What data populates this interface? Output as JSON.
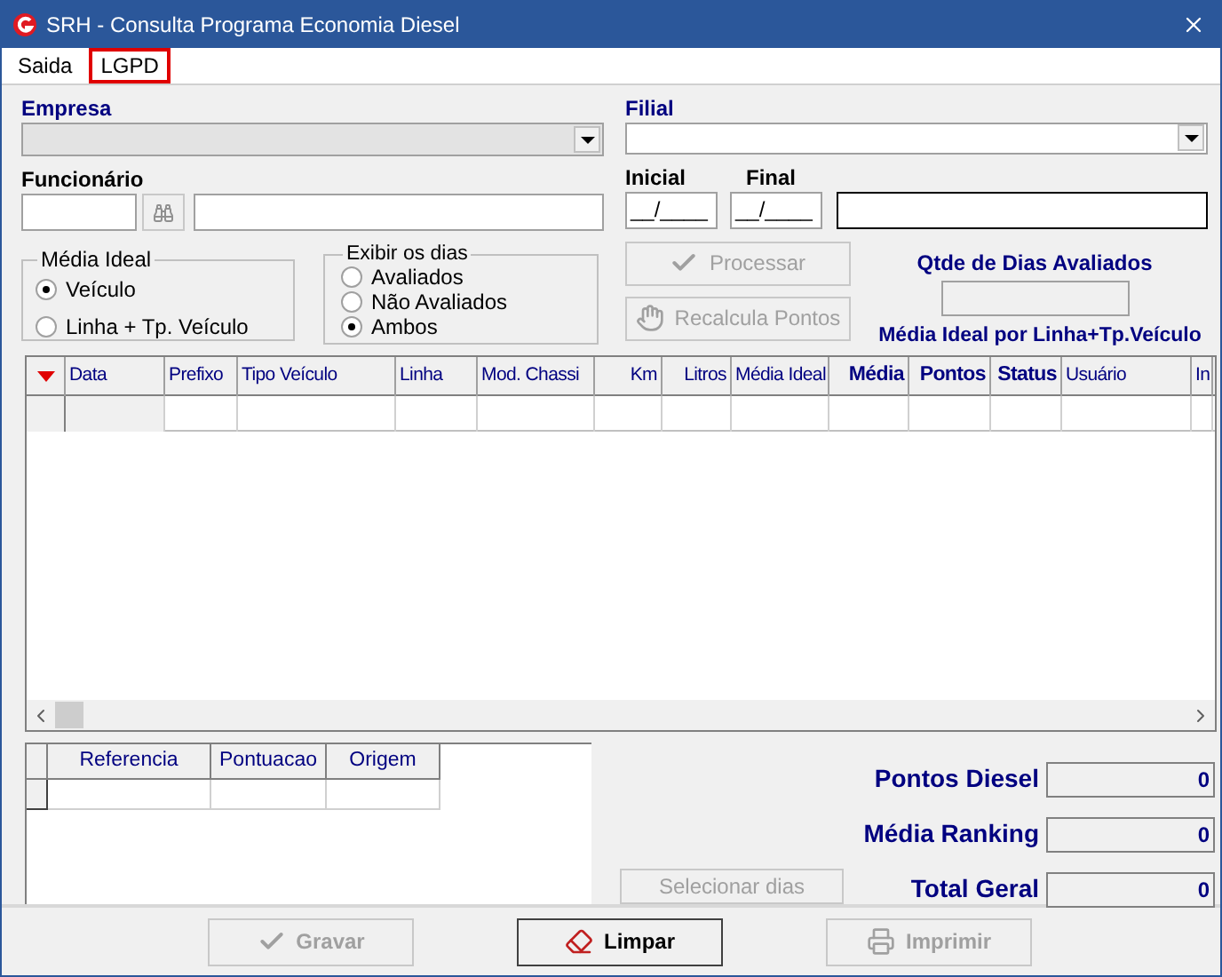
{
  "window": {
    "title": "SRH - Consulta Programa Economia Diesel"
  },
  "menu": [
    {
      "label": "Saida",
      "highlighted": false
    },
    {
      "label": "LGPD",
      "highlighted": true
    }
  ],
  "empresa": {
    "label": "Empresa",
    "disabled": true
  },
  "filial": {
    "label": "Filial",
    "disabled": false
  },
  "funcionario": {
    "label": "Funcionário"
  },
  "inicial": {
    "label": "Inicial",
    "value": "__/____"
  },
  "final": {
    "label": "Final",
    "value": "__/____"
  },
  "radio_groups": [
    {
      "title": "Média Ideal",
      "options": [
        {
          "label": "Veículo",
          "selected": true
        },
        {
          "label": "Linha + Tp. Veículo",
          "selected": false
        }
      ]
    },
    {
      "title": "Exibir os dias",
      "options": [
        {
          "label": "Avaliados",
          "selected": false
        },
        {
          "label": "Não Avaliados",
          "selected": false
        },
        {
          "label": "Ambos",
          "selected": true
        }
      ]
    }
  ],
  "action_buttons": [
    {
      "label": "Processar",
      "disabled": true,
      "kind": "check"
    },
    {
      "label": "Recalcula Pontos",
      "disabled": true,
      "kind": "hand"
    }
  ],
  "qtde_dias": {
    "label": "Qtde de Dias Avaliados"
  },
  "media_ideal_note": "Média Ideal por Linha+Tp.Veículo",
  "grid": {
    "columns": [
      {
        "label": "Data",
        "emphasized": false
      },
      {
        "label": "Prefixo",
        "emphasized": false
      },
      {
        "label": "Tipo Veículo",
        "emphasized": false
      },
      {
        "label": "Linha",
        "emphasized": false
      },
      {
        "label": "Mod. Chassi",
        "emphasized": false
      },
      {
        "label": "Km",
        "emphasized": false
      },
      {
        "label": "Litros",
        "emphasized": false
      },
      {
        "label": "Média Ideal",
        "emphasized": false
      },
      {
        "label": "Média",
        "emphasized": true
      },
      {
        "label": "Pontos",
        "emphasized": true
      },
      {
        "label": "Status",
        "emphasized": true
      },
      {
        "label": "Usuário",
        "emphasized": false
      },
      {
        "label": "In",
        "emphasized": false
      }
    ]
  },
  "sub_grid": {
    "columns": [
      "Referencia",
      "Pontuacao",
      "Origem"
    ]
  },
  "totals": [
    {
      "label": "Pontos Diesel",
      "value": "0"
    },
    {
      "label": "Média Ranking",
      "value": "0"
    },
    {
      "label": "Total Geral",
      "value": "0"
    }
  ],
  "selecionar": {
    "label": "Selecionar dias",
    "disabled": true
  },
  "footer_buttons": [
    {
      "label": "Gravar",
      "disabled": true,
      "kind": "check"
    },
    {
      "label": "Limpar",
      "disabled": false,
      "kind": "eraser"
    },
    {
      "label": "Imprimir",
      "disabled": true,
      "kind": "printer"
    }
  ]
}
